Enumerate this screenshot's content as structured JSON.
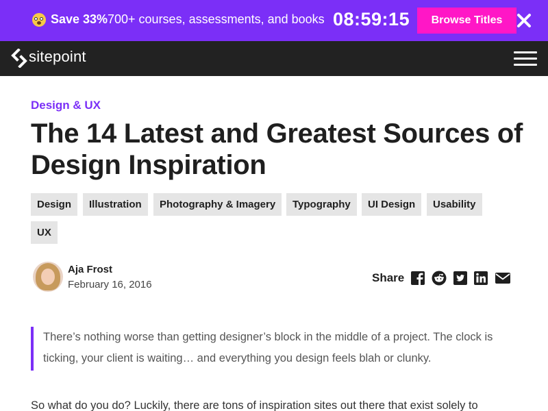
{
  "promo": {
    "save_label": "Save 33%",
    "offer_text": "700+ courses, assessments, and books",
    "countdown": "08:59:15",
    "browse_label": "Browse Titles",
    "emoji_icon": "shocked-face-emoji-icon",
    "close_icon": "close-icon",
    "background_color": "#7b2ff7",
    "button_color": "#ff17c6"
  },
  "nav": {
    "logo_text": "sitepoint",
    "logo_icon": "sitepoint-logo-icon",
    "menu_icon": "hamburger-menu-icon",
    "background_color": "#222222"
  },
  "article": {
    "category": "Design & UX",
    "title": "The 14 Latest and Greatest Sources of Design Inspiration",
    "tags": [
      "Design",
      "Illustration",
      "Photography & Imagery",
      "Typography",
      "UI Design",
      "Usability",
      "UX"
    ],
    "author": {
      "name": "Aja Frost",
      "date": "February 16, 2016"
    },
    "share": {
      "label": "Share",
      "icons": [
        "facebook-icon",
        "reddit-icon",
        "twitter-icon",
        "linkedin-icon",
        "email-icon"
      ]
    },
    "quote": "There’s nothing worse than getting designer’s block in the middle of a project. The clock is ticking, your client is waiting… and everything you design feels blah or clunky.",
    "paragraph": "So what do you do? Luckily, there are tons of inspiration sites out there that exist solely to",
    "accent_color": "#7b2ff7"
  }
}
